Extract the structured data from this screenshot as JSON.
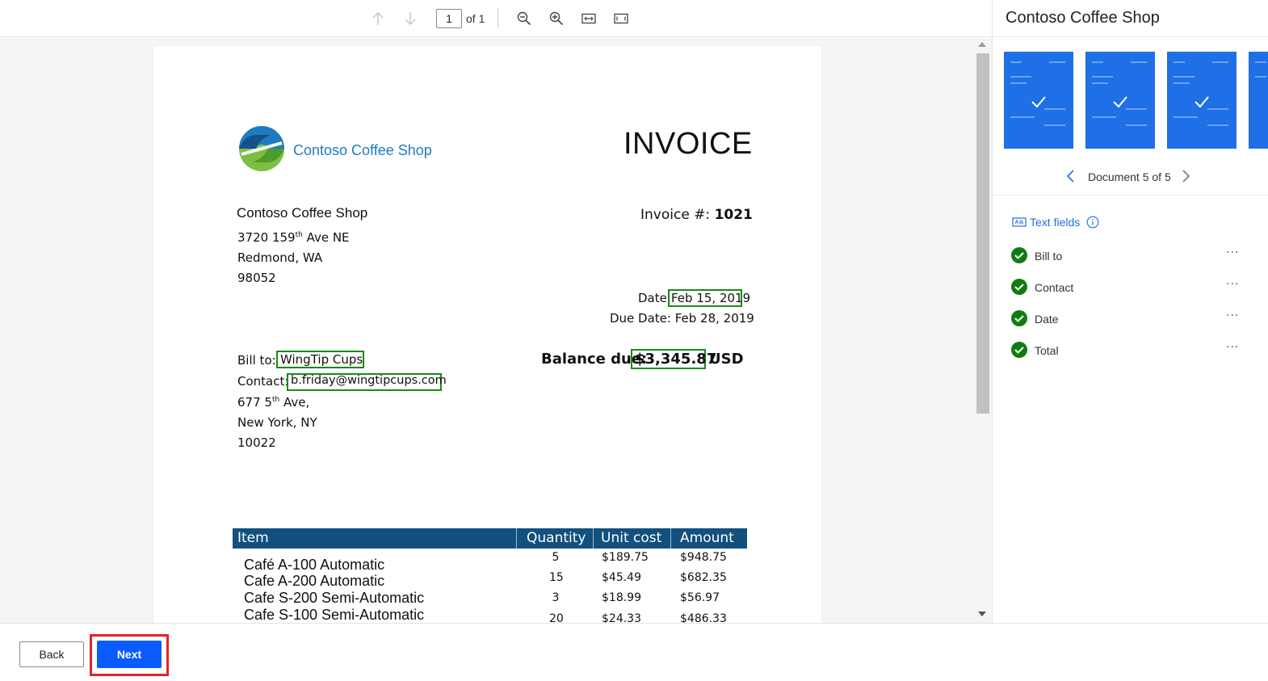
{
  "toolbar": {
    "page_current": "1",
    "page_of": "of 1"
  },
  "document": {
    "logo_name": "Contoso Coffee Shop",
    "title": "INVOICE",
    "seller_name": "Contoso Coffee Shop",
    "seller_street": "3720 159",
    "seller_street_sup": "th",
    "seller_street_end": " Ave NE",
    "seller_city": "Redmond, WA",
    "seller_zip": "98052",
    "invoice_label": "Invoice #: ",
    "invoice_number": "1021",
    "date_label": "Date:",
    "date_value": "Feb 15, 2019",
    "due_date": "Due Date: Feb 28, 2019",
    "bill_to_label": "Bill to: ",
    "bill_to_value": "WingTip Cups",
    "contact_label": "Contact:",
    "contact_value": "b.friday@wingtipcups.com",
    "addr_street": "677 5",
    "addr_street_sup": "th",
    "addr_street_end": " Ave,",
    "addr_city": "New York, NY",
    "addr_zip": "10022",
    "balance_label": "Balance due:",
    "balance_value": "$3,345.87",
    "balance_currency": "USD",
    "table": {
      "headers": [
        "Item",
        "Quantity",
        "Unit cost",
        "Amount"
      ],
      "rows": [
        {
          "item": "Café A-100 Automatic",
          "qty": "5",
          "unit": "$189.75",
          "amount": "$948.75"
        },
        {
          "item": "Cafe A-200 Automatic",
          "qty": "15",
          "unit": "$45.49",
          "amount": "$682.35"
        },
        {
          "item": "Cafe S-200 Semi-Automatic",
          "qty": "3",
          "unit": "$18.99",
          "amount": "$56.97"
        },
        {
          "item": "Cafe S-100 Semi-Automatic",
          "qty": "20",
          "unit": "$24.33",
          "amount": "$486.33"
        }
      ]
    }
  },
  "panel": {
    "title": "Contoso Coffee Shop",
    "doc_nav_label": "Document 5 of 5",
    "text_fields_label": "Text fields",
    "fields": [
      {
        "label": "Bill to",
        "more": "···"
      },
      {
        "label": "Contact",
        "more": "···"
      },
      {
        "label": "Date",
        "more": "···"
      },
      {
        "label": "Total",
        "more": "···"
      }
    ]
  },
  "footer": {
    "back_label": "Back",
    "next_label": "Next"
  },
  "colors": {
    "accent": "#0a5bff",
    "thumb": "#1f6fe6",
    "success": "#107c10",
    "highlight_box": "#1a8a1a",
    "table_header": "#12507f",
    "emphasis_outline": "#e0242a",
    "logo_text": "#1f7bc1"
  }
}
